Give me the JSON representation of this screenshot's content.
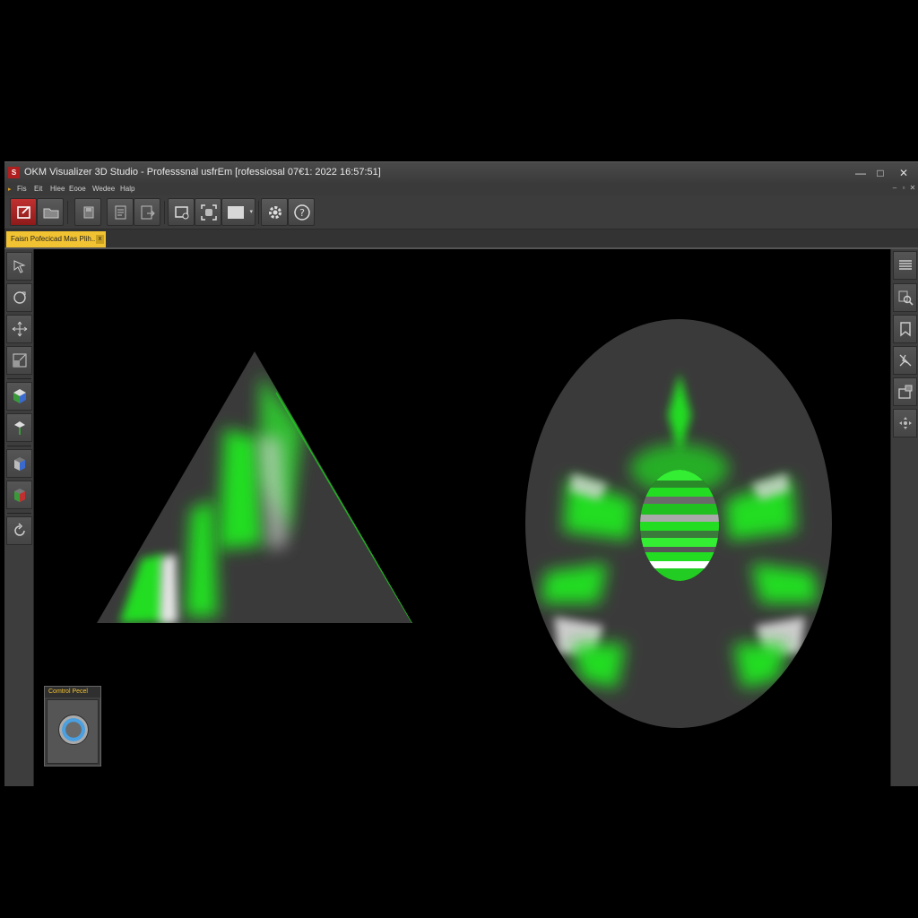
{
  "window": {
    "title": "OKM Visualizer 3D Studio - Professsnal usfrEm [rofessiosal 07€1: 2022 16:57:51]",
    "icon_label": "S",
    "controls": {
      "minimize": "—",
      "maximize": "□",
      "close": "✕"
    }
  },
  "menubar": {
    "items": [
      "Fis",
      "Eit",
      "Hiee",
      "Eooe",
      "Wedee",
      "Halp"
    ],
    "mdi_controls": [
      "–",
      "▫",
      "✕"
    ]
  },
  "toolbar": {
    "buttons": [
      {
        "icon": "new-scene-icon"
      },
      {
        "icon": "folder-icon"
      },
      {
        "icon": "save-icon"
      },
      {
        "icon": "document-icon"
      },
      {
        "icon": "export-icon"
      },
      {
        "icon": "screen-capture-icon"
      },
      {
        "icon": "target-frame-icon"
      },
      {
        "icon": "display-mode-icon"
      },
      {
        "icon": "gear-icon"
      },
      {
        "icon": "help-icon"
      }
    ]
  },
  "document_tab": {
    "label": "Faisn Pofecicad Mas Plih..",
    "close_label": "x"
  },
  "left_tools": [
    "select-arrow-icon",
    "rotate-icon",
    "move-icon",
    "scale-icon",
    "cube-icon",
    "pin-icon",
    "box-front-icon",
    "box-side-icon",
    "refresh-icon"
  ],
  "right_tools": [
    "layers-panel-icon",
    "zoom-search-icon",
    "bookmark-icon",
    "measure-icon",
    "snapshot-icon",
    "navigate-icon"
  ],
  "control_panel": {
    "title": "Comtrol Pecel"
  },
  "colors": {
    "accent": "#f1c232",
    "highlight": "#22dd22",
    "brand_red": "#b01f1f",
    "surface": "#3c3c3c"
  }
}
